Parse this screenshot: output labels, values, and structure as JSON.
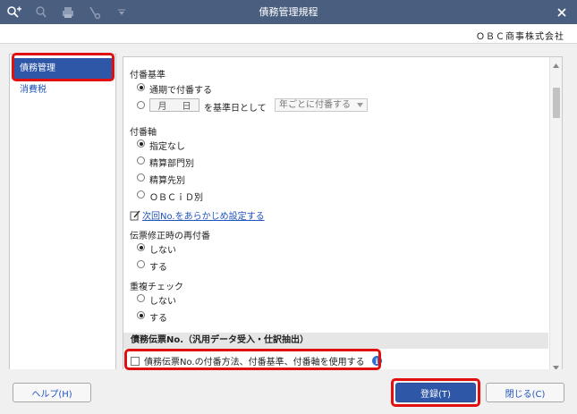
{
  "window": {
    "title": "債務管理規程",
    "close_glyph": "×",
    "toolbar_icons": [
      "search-add-icon",
      "search-icon",
      "print-icon",
      "tool-icon",
      "dropdown-arrow-icon"
    ]
  },
  "company": {
    "name": "ＯＢＣ商事株式会社"
  },
  "sidebar": {
    "items": [
      {
        "label": "債務管理",
        "active": true
      },
      {
        "label": "消費税",
        "active": false
      }
    ]
  },
  "numbering_basis": {
    "heading": "付番基準",
    "opt_continuous": "通期で付番する",
    "date_month": "月",
    "date_day": "日",
    "opt_date_suffix": "を基準日として",
    "select_value": "年ごとに付番する"
  },
  "numbering_axis": {
    "heading": "付番軸",
    "opt_none": "指定なし",
    "opt_dept": "精算部門別",
    "opt_payee": "精算先別",
    "opt_obcid": "ＯＢＣｉＤ別",
    "link": "次回No.をあらかじめ設定する"
  },
  "renumber": {
    "heading": "伝票修正時の再付番",
    "opt_no": "しない",
    "opt_yes": "する"
  },
  "dup_check": {
    "heading": "重複チェック",
    "opt_no": "しない",
    "opt_yes": "する"
  },
  "voucher_section": {
    "heading": "債務伝票No.（汎用データ受入・仕訳抽出）",
    "checkbox_label": "債務伝票No.の付番方法、付番基準、付番軸を使用する"
  },
  "footer": {
    "help": "ヘルプ(H)",
    "register": "登録(T)",
    "close": "閉じる(C)"
  },
  "colors": {
    "titlebar": "#4a5e80",
    "accent": "#2f57a8",
    "highlight": "#e01010",
    "link": "#2255bb"
  }
}
